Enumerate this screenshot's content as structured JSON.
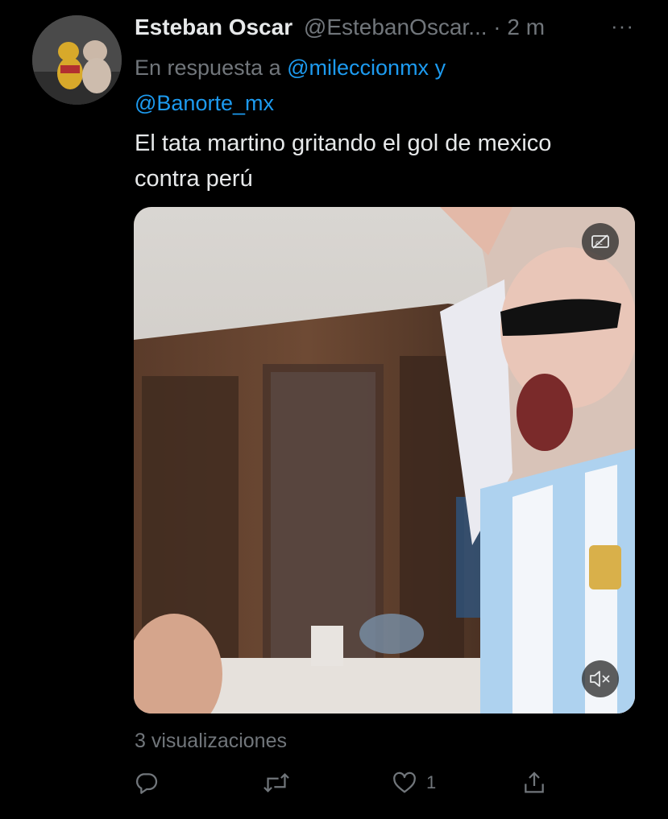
{
  "tweet": {
    "display_name": "Esteban Oscar",
    "handle": "@EstebanOscar...",
    "separator": " · ",
    "time": "2 m",
    "reply_prefix": "En respuesta a ",
    "reply_mention_1": "@mileccionmx",
    "reply_joiner": " y",
    "reply_mention_2": "@Banorte_mx",
    "text_line_1": "El tata martino gritando el gol de mexico",
    "text_line_2": "contra perú",
    "views": "3 visualizaciones",
    "like_count": "1",
    "more_label": "···"
  },
  "colors": {
    "background": "#000000",
    "primary_text": "#e7e9ea",
    "secondary_text": "#71767b",
    "mention": "#1d9bf0"
  },
  "icons": {
    "reply": "reply-icon",
    "retweet": "retweet-icon",
    "like": "heart-icon",
    "share": "share-icon",
    "captions": "closed-captions-off-icon",
    "mute": "muted-speaker-icon",
    "more": "more-icon"
  }
}
